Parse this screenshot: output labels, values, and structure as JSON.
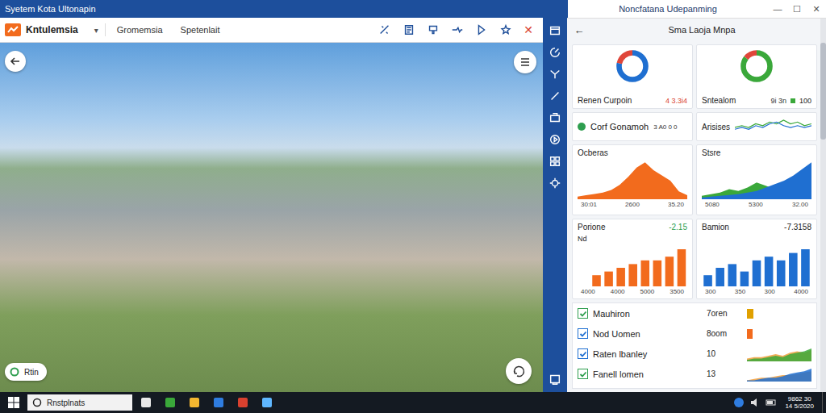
{
  "window": {
    "title": "Syetem Kota Ultonapin",
    "right_title": "Noncfatana Udepanming",
    "controls": [
      "—",
      "☐",
      "✕"
    ]
  },
  "toolbar": {
    "app": "Kntulemsia",
    "dropdown": "▾",
    "tabs": [
      {
        "label": "Gromemsia",
        "selected": false
      },
      {
        "label": "Spetenlait",
        "selected": false
      }
    ],
    "close": "✕"
  },
  "viewer": {
    "status": "Rtin"
  },
  "panel": {
    "back": "←",
    "title": "Sma Laoja Mnpa",
    "tiles": [
      {
        "kind": "gauge",
        "label": "Renen Curpoin",
        "value": "4 3.3i4",
        "value_color": "#d9412f",
        "segments": [
          {
            "level": 0.78,
            "color": "#1f6fd1"
          },
          {
            "level": 0.22,
            "color": "#e0463a"
          }
        ]
      },
      {
        "kind": "gauge",
        "label": "Sntealom",
        "value": "9i 3n",
        "extra": "100",
        "value_color": "#333333",
        "segments": [
          {
            "level": 0.85,
            "color": "#3aa83a"
          },
          {
            "level": 0.15,
            "color": "#e0463a"
          }
        ]
      },
      {
        "kind": "stat",
        "label": "Corf Gonamoh",
        "value": "3 A0 0 0"
      },
      {
        "kind": "spark",
        "label": "Arisises",
        "series": [
          {
            "color": "#3aa83a",
            "values": [
              4,
              5,
              4,
              6,
              5,
              7,
              6,
              8,
              6,
              7,
              5,
              6
            ]
          },
          {
            "color": "#1f6fd1",
            "values": [
              3,
              4,
              3,
              5,
              4,
              6,
              7,
              5,
              4,
              5,
              4,
              5
            ]
          }
        ]
      },
      {
        "kind": "area",
        "label": "Ocberas",
        "series": [
          {
            "color": "#f26b1d",
            "values": [
              4,
              6,
              8,
              10,
              14,
              22,
              34,
              48,
              56,
              44,
              36,
              28,
              12,
              6
            ]
          }
        ],
        "ticks": [
          "30:01",
          "2600",
          "35.20"
        ]
      },
      {
        "kind": "area",
        "label": "Stsre",
        "series": [
          {
            "color": "#3aa83a",
            "values": [
              4,
              6,
              8,
              12,
              10,
              14,
              20,
              16,
              12,
              10,
              8,
              6,
              5
            ]
          },
          {
            "color": "#1f6fd1",
            "values": [
              2,
              3,
              4,
              5,
              6,
              8,
              10,
              14,
              18,
              22,
              28,
              36,
              44
            ]
          }
        ],
        "ticks": [
          "5080",
          "5300",
          "32.00"
        ]
      },
      {
        "kind": "bars",
        "label": "Porione",
        "value": "-2.15",
        "value_color": "#2e9e4f",
        "axis": "Nd",
        "color": "#f26b1d",
        "values": [
          3,
          4,
          5,
          6,
          7,
          7,
          8,
          10
        ],
        "ticks": [
          "4000",
          "4000",
          "5000",
          "3500"
        ]
      },
      {
        "kind": "bars",
        "label": "Bamion",
        "value": "-7.3158",
        "value_color": "#222222",
        "color": "#1f6fd1",
        "values": [
          3,
          5,
          6,
          4,
          7,
          8,
          7,
          9,
          10
        ],
        "ticks": [
          "300",
          "350",
          "300",
          "4000"
        ]
      }
    ]
  },
  "list": [
    {
      "label": "Mauhiron",
      "value": "7oren",
      "checked": true,
      "check_color": "#2e9e4f",
      "kind": "bar",
      "level": 0.12,
      "color": "#e0a000"
    },
    {
      "label": "Nod Uomen",
      "value": "8oom",
      "checked": true,
      "check_color": "#1f6fd1",
      "kind": "bar",
      "level": 0.1,
      "color": "#f26b1d"
    },
    {
      "label": "Raten lbanley",
      "value": "10",
      "checked": true,
      "check_color": "#1f6fd1",
      "kind": "spark",
      "series": [
        {
          "color": "#f2a03d",
          "values": [
            2,
            3,
            3,
            4,
            5,
            4,
            6,
            7,
            6,
            8
          ]
        },
        {
          "color": "#3aa83a",
          "values": [
            1,
            2,
            2,
            3,
            4,
            3,
            5,
            6,
            7,
            9
          ]
        }
      ]
    },
    {
      "label": "Fanell lomen",
      "value": "13",
      "checked": true,
      "check_color": "#2e9e4f",
      "kind": "spark",
      "series": [
        {
          "color": "#f2a03d",
          "values": [
            1,
            2,
            3,
            3,
            4,
            5,
            5,
            6,
            7,
            8
          ]
        },
        {
          "color": "#1f6fd1",
          "values": [
            1,
            1,
            2,
            3,
            3,
            4,
            6,
            7,
            8,
            10
          ]
        }
      ]
    }
  ],
  "taskbar": {
    "search": "Rnstplnats",
    "time": "9862 30",
    "date": "14 5/2020"
  }
}
